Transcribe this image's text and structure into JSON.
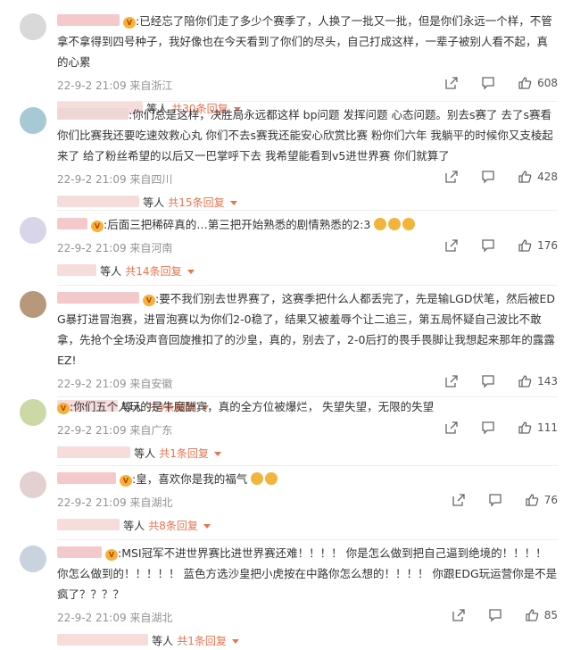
{
  "comments": [
    {
      "text": ":已经忘了陪你们走了多少个赛季了，人换了一批又一批，但是你们永远一个样，不管拿不拿得到四号种子，我好像也在今天看到了你们的尽头，自己打成这样，一辈子被别人看不起，真的心累",
      "time": "22-9-2 21:09 来自浙江",
      "likes": "608",
      "reply_prefix": "等人",
      "reply_link": "共30条回复",
      "badge": "1"
    },
    {
      "text": ":你们总是这样，决胜局永远都这样 bp问题 发挥问题 心态问题。别去s赛了 去了s赛看你们比赛我还要吃速效救心丸 你们不去s赛我还能安心欣赏比赛 粉你们六年 我躺平的时候你又支棱起来了 给了粉丝希望的以后又一巴掌呼下去 我希望能看到v5进世界赛 你们就算了",
      "time": "22-9-2 21:09 来自四川",
      "likes": "428",
      "reply_prefix": "等人",
      "reply_link": "共15条回复",
      "badge": ""
    },
    {
      "text": ":后面三把稀碎真的…第三把开始熟悉的剧情熟悉的2:3",
      "time": "22-9-2 21:09 来自河南",
      "likes": "176",
      "reply_prefix": "等人",
      "reply_link": "共14条回复",
      "badge": "1"
    },
    {
      "text": ":要不我们别去世界赛了，这赛季把什么人都丢完了，先是输LGD伏笔，然后被EDG暴打进冒泡赛，进冒泡赛以为你们2-0稳了，结果又被羞辱个让二追三，第五局怀疑自己波比不敢拿，先抢个全场没声音回旋推扣了的沙皇，真的，别去了，2-0后打的畏手畏脚让我想起来那年的露露EZ!",
      "time": "22-9-2 21:09 来自安徽",
      "likes": "143",
      "reply_prefix": "等人",
      "reply_link": "共4条回复",
      "badge": "1"
    },
    {
      "text": ":你们五个人玩的是牛魔酬宾，真的全方位被爆烂， 失望失望，无限的失望",
      "time": "22-9-2 21:09 来自广东",
      "likes": "111",
      "reply_prefix": "等人",
      "reply_link": "共1条回复",
      "badge": "1"
    },
    {
      "text": ":皇，喜欢你是我的福气",
      "time": "22-9-2 21:09 来自湖北",
      "likes": "76",
      "reply_prefix": "等人",
      "reply_link": "共8条回复",
      "badge": "1"
    },
    {
      "text": ":MSI冠军不进世界赛比进世界赛还难！！！！ 你是怎么做到把自己逼到绝境的！！！！ 你怎么做到的！！！！！ 蓝色方选沙皇把小虎按在中路你怎么想的！！！！ 你跟EDG玩运营你是不是疯了？？？？",
      "time": "22-9-2 21:09 来自湖北",
      "likes": "85",
      "reply_prefix": "等人",
      "reply_link": "共1条回复",
      "badge": "1"
    }
  ],
  "colors": {
    "link": "#eb7350",
    "meta": "#939393",
    "text": "#333333"
  },
  "icons": [
    "share-icon",
    "comment-icon",
    "like-icon"
  ]
}
